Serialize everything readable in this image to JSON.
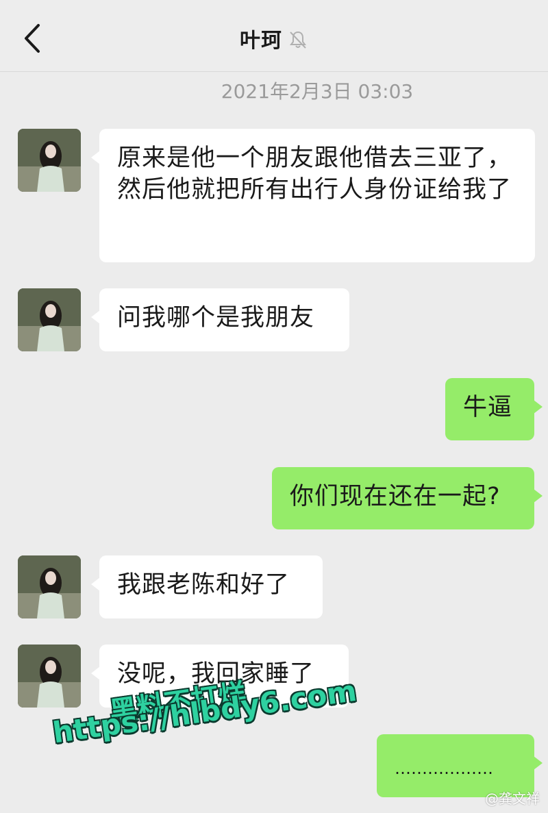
{
  "header": {
    "title": "叶珂",
    "back_icon": "chevron-left-icon",
    "mute_icon": "bell-muted-icon"
  },
  "timestamp": "2021年2月3日 03:03",
  "messages": [
    {
      "side": "left",
      "text": "原来是他一个朋友跟他借去三亚了，然后他就把所有出行人身份证给我了"
    },
    {
      "side": "left",
      "text": "问我哪个是我朋友"
    },
    {
      "side": "right",
      "text": "牛逼"
    },
    {
      "side": "right",
      "text": "你们现在还在一起?"
    },
    {
      "side": "left",
      "text": "我跟老陈和好了"
    },
    {
      "side": "left",
      "text": "没呢，我回家睡了"
    },
    {
      "side": "right",
      "text": "………………"
    }
  ],
  "watermark": {
    "line1": "黑料不打烊",
    "line2": "https://hlbdy6.com"
  },
  "credit": "@龚文祥",
  "colors": {
    "background": "#ececec",
    "bubble_left": "#ffffff",
    "bubble_right": "#95ec69",
    "watermark": "#2ed1a0"
  }
}
